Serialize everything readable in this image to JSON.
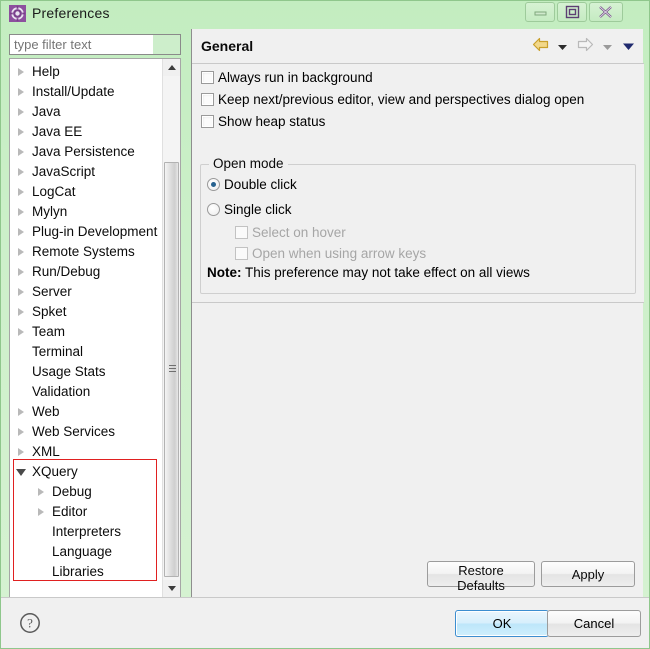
{
  "window": {
    "title": "Preferences",
    "icon": "preferences-gear-icon",
    "controls": [
      {
        "name": "minimize",
        "glyph": "minimize-icon"
      },
      {
        "name": "maximize",
        "glyph": "maximize-icon"
      },
      {
        "name": "close",
        "glyph": "close-icon"
      }
    ],
    "titlebar_color": "#c3edc0"
  },
  "filter": {
    "value": "",
    "placeholder": "type filter text"
  },
  "tree": {
    "items": [
      {
        "label": "Help",
        "indent": 0,
        "state": "collapsed"
      },
      {
        "label": "Install/Update",
        "indent": 0,
        "state": "collapsed"
      },
      {
        "label": "Java",
        "indent": 0,
        "state": "collapsed"
      },
      {
        "label": "Java EE",
        "indent": 0,
        "state": "collapsed"
      },
      {
        "label": "Java Persistence",
        "indent": 0,
        "state": "collapsed"
      },
      {
        "label": "JavaScript",
        "indent": 0,
        "state": "collapsed"
      },
      {
        "label": "LogCat",
        "indent": 0,
        "state": "collapsed"
      },
      {
        "label": "Mylyn",
        "indent": 0,
        "state": "collapsed"
      },
      {
        "label": "Plug-in Development",
        "indent": 0,
        "state": "collapsed"
      },
      {
        "label": "Remote Systems",
        "indent": 0,
        "state": "collapsed"
      },
      {
        "label": "Run/Debug",
        "indent": 0,
        "state": "collapsed"
      },
      {
        "label": "Server",
        "indent": 0,
        "state": "collapsed"
      },
      {
        "label": "Spket",
        "indent": 0,
        "state": "collapsed"
      },
      {
        "label": "Team",
        "indent": 0,
        "state": "collapsed"
      },
      {
        "label": "Terminal",
        "indent": 0,
        "state": "leaf"
      },
      {
        "label": "Usage Stats",
        "indent": 0,
        "state": "leaf"
      },
      {
        "label": "Validation",
        "indent": 0,
        "state": "leaf"
      },
      {
        "label": "Web",
        "indent": 0,
        "state": "collapsed"
      },
      {
        "label": "Web Services",
        "indent": 0,
        "state": "collapsed"
      },
      {
        "label": "XML",
        "indent": 0,
        "state": "collapsed"
      },
      {
        "label": "XQuery",
        "indent": 0,
        "state": "expanded"
      },
      {
        "label": "Debug",
        "indent": 1,
        "state": "collapsed"
      },
      {
        "label": "Editor",
        "indent": 1,
        "state": "collapsed"
      },
      {
        "label": "Interpreters",
        "indent": 1,
        "state": "leaf"
      },
      {
        "label": "Language",
        "indent": 1,
        "state": "leaf"
      },
      {
        "label": "Libraries",
        "indent": 1,
        "state": "leaf"
      }
    ],
    "highlight": {
      "color": "#e02020",
      "from_label": "XQuery",
      "to_label": "Libraries"
    },
    "scrollbar": {
      "position_pct": 19
    }
  },
  "page": {
    "title": "General",
    "nav": {
      "back": "back-arrow-icon",
      "back_menu": "back-dropdown-icon",
      "forward": "forward-arrow-icon",
      "forward_menu": "forward-dropdown-icon",
      "view_menu": "view-menu-dropdown-icon",
      "back_color": "#e0b63a",
      "forward_color": "#c8c8c8",
      "menu_color": "#1f2a6e"
    },
    "checkboxes": [
      {
        "label": "Always run in background",
        "checked": false,
        "enabled": true
      },
      {
        "label": "Keep next/previous editor, view and perspectives dialog open",
        "checked": false,
        "enabled": true
      },
      {
        "label": "Show heap status",
        "checked": false,
        "enabled": true
      }
    ],
    "open_mode": {
      "legend": "Open mode",
      "radios": [
        {
          "label": "Double click",
          "selected": true
        },
        {
          "label": "Single click",
          "selected": false
        }
      ],
      "sub_checkboxes": [
        {
          "label": "Select on hover",
          "checked": false,
          "enabled": false
        },
        {
          "label": "Open when using arrow keys",
          "checked": false,
          "enabled": false
        }
      ],
      "note_prefix": "Note:",
      "note_text": "This preference may not take effect on all views"
    },
    "buttons": {
      "restore_defaults": "Restore Defaults",
      "apply": "Apply"
    }
  },
  "footer": {
    "help": "help-icon",
    "ok": "OK",
    "cancel": "Cancel",
    "ok_accent": "#3c8ed0"
  }
}
